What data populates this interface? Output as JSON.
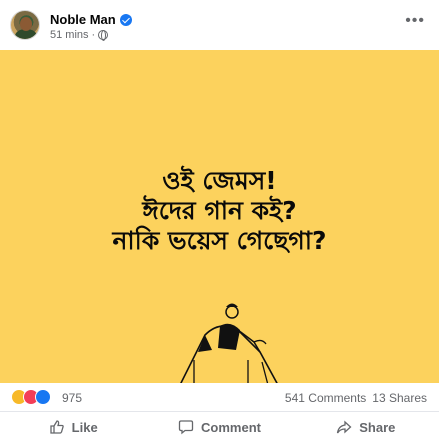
{
  "post": {
    "author": "Noble Man",
    "time": "51 mins",
    "separator": "·",
    "image_text": [
      "ওই জেমস!",
      "ঈদের গান কই?",
      "নাকি ভয়েস গেছেগা?"
    ],
    "reaction_count": "975",
    "comments": "541 Comments",
    "shares": "13 Shares",
    "actions": {
      "like": "Like",
      "comment": "Comment",
      "share": "Share"
    },
    "icons": [
      "verified-badge-icon",
      "globe-icon",
      "more-options-icon",
      "haha-reaction-icon",
      "love-reaction-icon",
      "like-reaction-icon",
      "like-icon",
      "comment-icon",
      "share-icon"
    ],
    "colors": {
      "image_background": "#fcd25d",
      "accent": "#1877f2",
      "muted_text": "#65676b"
    }
  }
}
